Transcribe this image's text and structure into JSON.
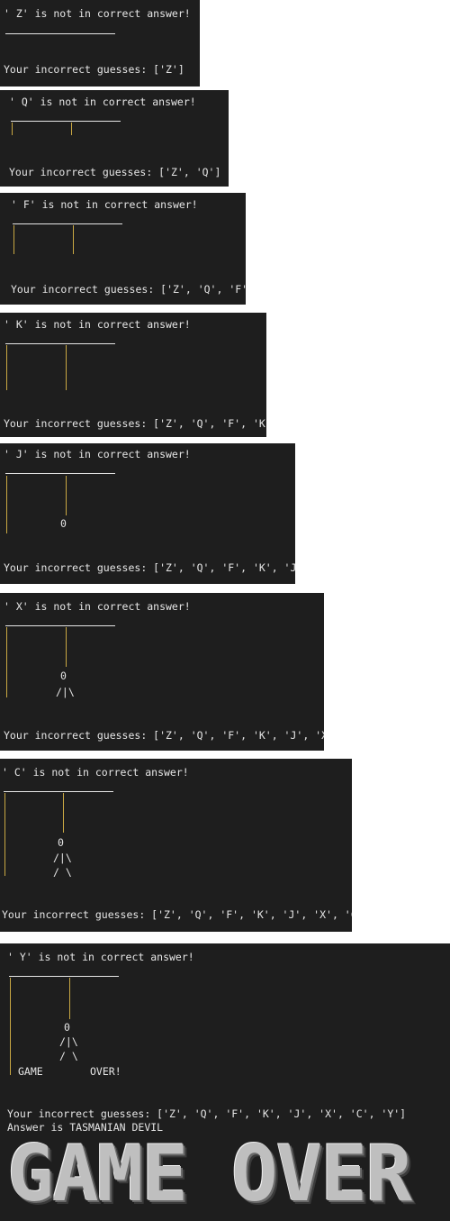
{
  "panels": [
    {
      "message": "' Z' is not in correct answer!",
      "incorrect": "Your incorrect guesses: ['Z']"
    },
    {
      "message": "' Q' is not in correct answer!",
      "incorrect": "Your incorrect guesses: ['Z', 'Q']"
    },
    {
      "message": "' F' is not in correct answer!",
      "incorrect": "Your incorrect guesses: ['Z', 'Q', 'F']"
    },
    {
      "message": "' K' is not in correct answer!",
      "incorrect": "Your incorrect guesses: ['Z', 'Q', 'F', 'K']"
    },
    {
      "message": "' J' is not in correct answer!",
      "incorrect": "Your incorrect guesses: ['Z', 'Q', 'F', 'K', 'J']",
      "head": "0"
    },
    {
      "message": "' X' is not in correct answer!",
      "incorrect": "Your incorrect guesses: ['Z', 'Q', 'F', 'K', 'J', 'X']",
      "head": "0",
      "body": "/|\\"
    },
    {
      "message": "' C' is not in correct answer!",
      "incorrect": "Your incorrect guesses: ['Z', 'Q', 'F', 'K', 'J', 'X', 'C']",
      "head": "0",
      "body": "/|\\",
      "legs": "/ \\"
    },
    {
      "message": "' Y' is not in correct answer!",
      "incorrect": "Your incorrect guesses: ['Z', 'Q', 'F', 'K', 'J', 'X', 'C', 'Y']",
      "head": "0",
      "body": "/|\\",
      "legs": "/ \\",
      "game_word": "GAME",
      "over_word": "OVER!"
    }
  ],
  "answer_line": "Answer is TASMANIAN DEVIL",
  "game_over_banner": "GAME OVER",
  "colors": {
    "terminal_bg": "#1e1e1e",
    "text": "#e6e6e6",
    "gallows": "#c9a843"
  }
}
